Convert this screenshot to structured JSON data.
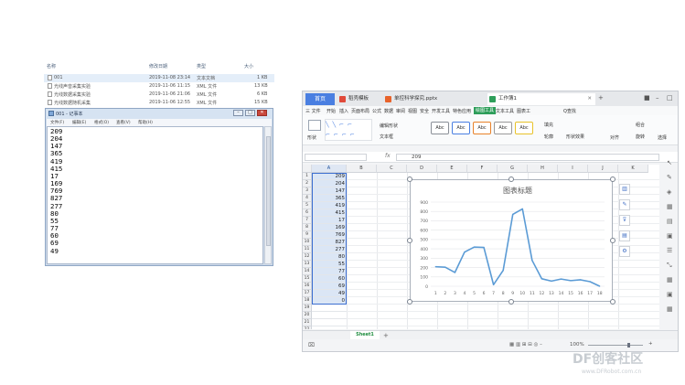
{
  "explorer": {
    "columns": [
      "名称",
      "修改日期",
      "类型",
      "大小"
    ],
    "files": [
      {
        "name": "001",
        "date": "2019-11-08 23:14",
        "type": "文本文档",
        "size": "1 KB"
      },
      {
        "name": "光线声音采集实验",
        "date": "2019-11-06 11:15",
        "type": "XML 文件",
        "size": "13 KB"
      },
      {
        "name": "光线数据采集实验",
        "date": "2019-11-06 21:06",
        "type": "XML 文件",
        "size": "6 KB"
      },
      {
        "name": "光线数据随机采集",
        "date": "2019-11-06 12:55",
        "type": "XML 文件",
        "size": "15 KB"
      }
    ]
  },
  "notepad": {
    "title": "001 - 记事本",
    "menu": [
      "文件(F)",
      "编辑(E)",
      "格式(O)",
      "查看(V)",
      "帮助(H)"
    ],
    "lines": [
      "209",
      "204",
      "147",
      "365",
      "419",
      "415",
      "17",
      "169",
      "769",
      "827",
      "277",
      "80",
      "55",
      "77",
      "60",
      "69",
      "49"
    ]
  },
  "wps": {
    "home_tab": "首页",
    "tabs": [
      {
        "label": "稻壳模板",
        "color": "#e04a3a"
      },
      {
        "label": "单控科学探究.pptx",
        "color": "#e8632b"
      },
      {
        "label": "工作簿1",
        "color": "#2e9e5a"
      }
    ],
    "menu": [
      "三 文件",
      "开始",
      "插入",
      "页面布局",
      "公式",
      "数据",
      "审阅",
      "视图",
      "安全",
      "开发工具",
      "特色应用",
      "绘图工具",
      "文本工具",
      "图表工"
    ],
    "active_menu": "绘图工具",
    "search_label": "Q查找",
    "ribbon": {
      "shape_label": "形状",
      "edit_shape": "编辑形状",
      "textbox": "文本框",
      "style_label": "Abc",
      "fill": "填充",
      "outline": "轮廓",
      "shape_effect": "形状效果",
      "align": "对齐",
      "group": "组合",
      "rotate": "旋转",
      "select": "选择"
    },
    "formula": {
      "fx": "fx",
      "value": "209"
    },
    "columns": [
      "A",
      "B",
      "C",
      "D",
      "E",
      "F",
      "G",
      "H",
      "I",
      "J",
      "K"
    ],
    "rows": [
      "1",
      "2",
      "3",
      "4",
      "5",
      "6",
      "7",
      "8",
      "9",
      "10",
      "11",
      "12",
      "13",
      "14",
      "15",
      "16",
      "17",
      "18",
      "19",
      "20",
      "21",
      "22"
    ],
    "col_a_values": [
      "209",
      "204",
      "147",
      "365",
      "419",
      "415",
      "17",
      "169",
      "769",
      "827",
      "277",
      "80",
      "55",
      "77",
      "60",
      "69",
      "49",
      "0"
    ],
    "sheet_tab": "Sheet1",
    "zoom": "100%"
  },
  "chart_data": {
    "type": "line",
    "title": "图表标题",
    "categories": [
      "1",
      "2",
      "3",
      "4",
      "5",
      "6",
      "7",
      "8",
      "9",
      "10",
      "11",
      "12",
      "13",
      "14",
      "15",
      "16",
      "17",
      "18"
    ],
    "series": [
      {
        "values": [
          209,
          204,
          147,
          365,
          419,
          415,
          17,
          169,
          769,
          827,
          277,
          80,
          55,
          77,
          60,
          69,
          49,
          0
        ]
      }
    ],
    "ylim": [
      0,
      900
    ],
    "yticks": [
      "0",
      "100",
      "200",
      "300",
      "400",
      "500",
      "600",
      "700",
      "800",
      "900"
    ],
    "color": "#5b9bd5",
    "grid": true
  },
  "watermark": {
    "main": "DF创客社区",
    "sub": "www.DFRobot.com.cn"
  }
}
